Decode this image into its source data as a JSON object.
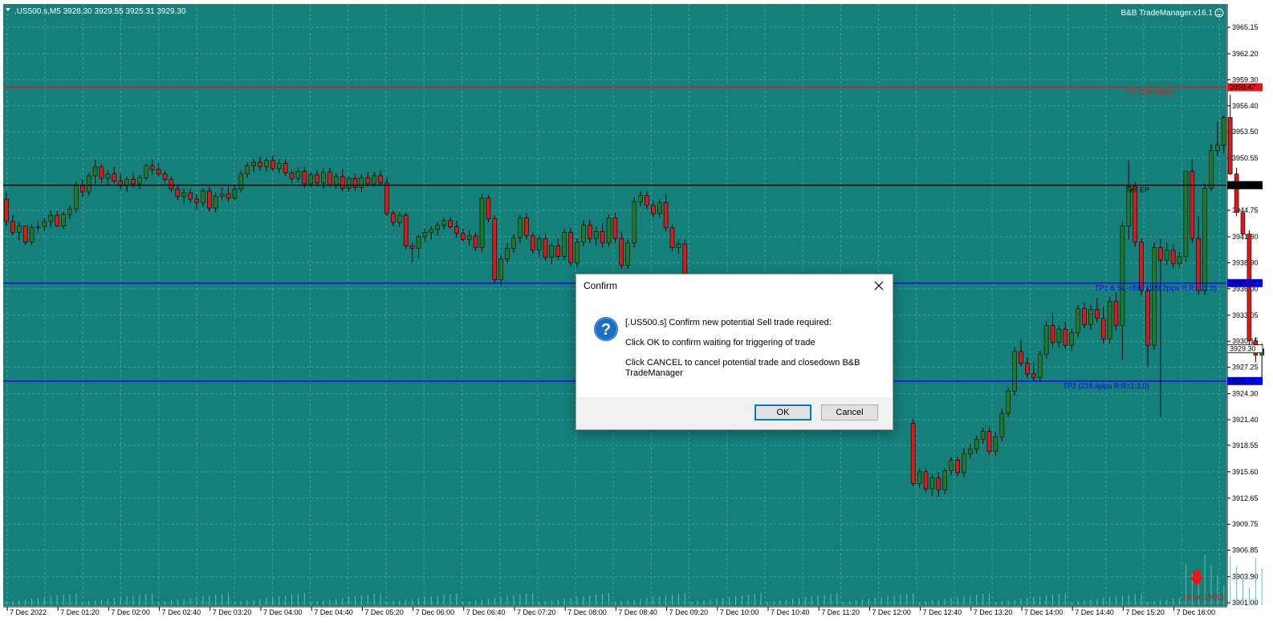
{
  "chart": {
    "symbol_header": ".US500.s,M5  3928.30 3929.55 3925.31 3929.30",
    "ea_label": "B&B TradeManager.v16.1",
    "background": "#148079",
    "grid_color": "#3fa39b",
    "price_ticks": [
      "3965.15",
      "3962.20",
      "3959.30",
      "3956.40",
      "3953.50",
      "3950.55",
      "3947.55",
      "3944.75",
      "3941.80",
      "3938.90",
      "3936.00",
      "3933.05",
      "3930.15",
      "3927.25",
      "3924.30",
      "3921.40",
      "3918.55",
      "3915.60",
      "3912.65",
      "3909.75",
      "3906.85",
      "3903.90",
      "3901.00"
    ],
    "time_ticks": [
      "7 Dec 2022",
      "7 Dec 01:20",
      "7 Dec 02:00",
      "7 Dec 02:40",
      "7 Dec 03:20",
      "7 Dec 04:00",
      "7 Dec 04:40",
      "7 Dec 05:20",
      "7 Dec 06:00",
      "7 Dec 06:40",
      "7 Dec 07:20",
      "7 Dec 08:00",
      "7 Dec 08:40",
      "7 Dec 09:20",
      "7 Dec 10:00",
      "7 Dec 10:40",
      "7 Dec 11:20",
      "7 Dec 12:00",
      "7 Dec 12:40",
      "7 Dec 13:20",
      "7 Dec 14:00",
      "7 Dec 14:40",
      "7 Dec 15:20",
      "7 Dec 16:00"
    ],
    "levels": {
      "sl": {
        "price": 3958.47,
        "label": "SL (108.2pips)",
        "tag": "3958.47",
        "color": "#e3171b"
      },
      "entry": {
        "price": 3947.55,
        "label": "Sell EP",
        "tag": "3947.55",
        "color": "#000000"
      },
      "tp1": {
        "price": 3936.63,
        "label": "TP1 & SL->B/E (109.2pips R:R=1:1.0)",
        "tag": "3936.63",
        "color": "#0000ff"
      },
      "tp2": {
        "price": 3925.71,
        "label": "TP2 (218.4pips R:R=1:2.0)",
        "tag": "3925.71",
        "color": "#0000ff"
      },
      "current": {
        "price": 3929.3,
        "tag": "3929.30"
      }
    },
    "timer": "(0min 10:00)",
    "up_color": "#1e7a2a",
    "down_color": "#d51b1b",
    "arrow_icon": "red-down-arrow-icon"
  },
  "chart_data": {
    "type": "candlestick",
    "ylim": [
      3901.0,
      3965.15
    ],
    "candles": [
      [
        3946.0,
        3946.8,
        3942.9,
        3943.5
      ],
      [
        3943.5,
        3944.2,
        3942.0,
        3942.3
      ],
      [
        3942.3,
        3943.5,
        3941.4,
        3943.0
      ],
      [
        3943.0,
        3943.0,
        3940.9,
        3941.2
      ],
      [
        3941.2,
        3943.2,
        3940.8,
        3942.8
      ],
      [
        3942.8,
        3943.6,
        3942.2,
        3942.9
      ],
      [
        3942.9,
        3943.9,
        3942.4,
        3943.5
      ],
      [
        3943.5,
        3944.8,
        3942.8,
        3944.2
      ],
      [
        3944.2,
        3944.7,
        3942.9,
        3943.0
      ],
      [
        3943.0,
        3944.6,
        3942.7,
        3944.3
      ],
      [
        3944.3,
        3945.3,
        3943.8,
        3944.9
      ],
      [
        3944.9,
        3947.9,
        3944.5,
        3947.5
      ],
      [
        3947.5,
        3948.2,
        3946.2,
        3946.8
      ],
      [
        3946.8,
        3948.9,
        3946.4,
        3948.6
      ],
      [
        3948.6,
        3950.4,
        3947.7,
        3949.6
      ],
      [
        3949.6,
        3949.9,
        3947.8,
        3948.3
      ],
      [
        3948.3,
        3949.2,
        3947.6,
        3948.8
      ],
      [
        3948.8,
        3949.6,
        3947.8,
        3948.0
      ],
      [
        3948.0,
        3948.9,
        3947.1,
        3947.5
      ],
      [
        3947.5,
        3948.5,
        3946.8,
        3948.2
      ],
      [
        3948.2,
        3948.9,
        3947.3,
        3947.7
      ],
      [
        3947.7,
        3948.7,
        3947.1,
        3948.4
      ],
      [
        3948.4,
        3950.0,
        3948.1,
        3949.7
      ],
      [
        3949.7,
        3950.4,
        3948.7,
        3949.3
      ],
      [
        3949.3,
        3950.0,
        3948.5,
        3948.8
      ],
      [
        3948.8,
        3949.2,
        3947.6,
        3948.2
      ],
      [
        3948.2,
        3948.6,
        3946.8,
        3947.1
      ],
      [
        3947.1,
        3947.6,
        3945.9,
        3946.3
      ],
      [
        3946.3,
        3947.1,
        3945.5,
        3946.7
      ],
      [
        3946.7,
        3947.1,
        3945.6,
        3946.0
      ],
      [
        3946.0,
        3946.5,
        3944.8,
        3945.6
      ],
      [
        3945.6,
        3947.2,
        3945.1,
        3946.9
      ],
      [
        3946.9,
        3947.4,
        3944.6,
        3945.0
      ],
      [
        3945.0,
        3946.7,
        3944.5,
        3946.3
      ],
      [
        3946.3,
        3947.3,
        3945.8,
        3946.6
      ],
      [
        3946.6,
        3947.4,
        3945.7,
        3946.1
      ],
      [
        3946.1,
        3947.5,
        3945.9,
        3947.1
      ],
      [
        3947.1,
        3949.2,
        3946.7,
        3948.8
      ],
      [
        3948.8,
        3950.1,
        3948.4,
        3949.7
      ],
      [
        3949.7,
        3950.5,
        3949.0,
        3950.1
      ],
      [
        3950.1,
        3950.7,
        3949.2,
        3949.6
      ],
      [
        3949.6,
        3950.6,
        3949.1,
        3950.3
      ],
      [
        3950.3,
        3950.9,
        3949.2,
        3949.4
      ],
      [
        3949.4,
        3950.5,
        3948.9,
        3950.0
      ],
      [
        3950.0,
        3950.4,
        3948.6,
        3948.9
      ],
      [
        3948.9,
        3949.3,
        3947.7,
        3948.3
      ],
      [
        3948.3,
        3949.6,
        3947.9,
        3949.1
      ],
      [
        3949.1,
        3949.6,
        3947.3,
        3947.7
      ],
      [
        3947.7,
        3949.0,
        3947.3,
        3948.7
      ],
      [
        3948.7,
        3949.2,
        3947.4,
        3947.8
      ],
      [
        3947.8,
        3949.4,
        3947.2,
        3949.0
      ],
      [
        3949.0,
        3949.5,
        3947.4,
        3947.6
      ],
      [
        3947.6,
        3948.9,
        3947.2,
        3948.5
      ],
      [
        3948.5,
        3949.3,
        3946.9,
        3947.2
      ],
      [
        3947.2,
        3948.6,
        3946.8,
        3948.3
      ],
      [
        3948.3,
        3948.8,
        3946.9,
        3947.3
      ],
      [
        3947.3,
        3948.8,
        3946.8,
        3948.4
      ],
      [
        3948.4,
        3949.0,
        3947.4,
        3947.7
      ],
      [
        3947.7,
        3949.0,
        3947.4,
        3948.6
      ],
      [
        3948.6,
        3949.2,
        3947.6,
        3947.8
      ],
      [
        3947.8,
        3948.4,
        3944.1,
        3944.4
      ],
      [
        3944.4,
        3944.7,
        3943.0,
        3943.4
      ],
      [
        3943.4,
        3944.6,
        3942.9,
        3944.2
      ],
      [
        3944.2,
        3944.5,
        3940.4,
        3940.8
      ],
      [
        3940.8,
        3941.1,
        3938.9,
        3940.5
      ],
      [
        3940.5,
        3942.1,
        3939.4,
        3941.8
      ],
      [
        3941.8,
        3942.7,
        3941.2,
        3942.3
      ],
      [
        3942.3,
        3943.0,
        3941.5,
        3942.6
      ],
      [
        3942.6,
        3943.4,
        3941.9,
        3943.1
      ],
      [
        3943.1,
        3943.9,
        3942.6,
        3943.6
      ],
      [
        3943.6,
        3944.0,
        3942.7,
        3942.9
      ],
      [
        3942.9,
        3943.6,
        3941.7,
        3942.2
      ],
      [
        3942.2,
        3942.7,
        3941.3,
        3941.5
      ],
      [
        3941.5,
        3942.5,
        3940.8,
        3941.9
      ],
      [
        3941.9,
        3942.4,
        3940.2,
        3940.6
      ],
      [
        3940.6,
        3946.6,
        3940.1,
        3946.1
      ],
      [
        3946.1,
        3946.5,
        3943.4,
        3943.8
      ],
      [
        3943.8,
        3944.2,
        3936.6,
        3937.0
      ],
      [
        3937.0,
        3939.8,
        3936.4,
        3939.3
      ],
      [
        3939.3,
        3941.1,
        3938.9,
        3940.5
      ],
      [
        3940.5,
        3942.1,
        3940.0,
        3941.7
      ],
      [
        3941.7,
        3944.2,
        3941.1,
        3943.9
      ],
      [
        3943.9,
        3944.4,
        3941.5,
        3941.9
      ],
      [
        3941.9,
        3942.3,
        3939.9,
        3940.3
      ],
      [
        3940.3,
        3942.0,
        3939.5,
        3941.6
      ],
      [
        3941.6,
        3942.1,
        3939.1,
        3939.5
      ],
      [
        3939.5,
        3941.2,
        3938.7,
        3940.8
      ],
      [
        3940.8,
        3941.6,
        3939.2,
        3939.6
      ],
      [
        3939.6,
        3942.7,
        3939.2,
        3942.3
      ],
      [
        3942.3,
        3942.8,
        3938.5,
        3938.9
      ],
      [
        3938.9,
        3941.6,
        3938.4,
        3941.2
      ],
      [
        3941.2,
        3943.6,
        3940.7,
        3943.1
      ],
      [
        3943.1,
        3943.7,
        3941.1,
        3941.6
      ],
      [
        3941.6,
        3942.9,
        3940.8,
        3942.4
      ],
      [
        3942.4,
        3943.3,
        3940.6,
        3941.1
      ],
      [
        3941.1,
        3944.3,
        3940.7,
        3943.9
      ],
      [
        3943.9,
        3944.5,
        3941.1,
        3941.6
      ],
      [
        3941.6,
        3942.4,
        3938.2,
        3938.6
      ],
      [
        3938.6,
        3941.5,
        3938.2,
        3941.1
      ],
      [
        3941.1,
        3946.2,
        3940.6,
        3945.7
      ],
      [
        3945.7,
        3946.9,
        3945.2,
        3946.4
      ],
      [
        3946.4,
        3946.8,
        3944.9,
        3945.3
      ],
      [
        3945.3,
        3945.8,
        3944.0,
        3944.4
      ],
      [
        3944.4,
        3946.0,
        3943.9,
        3945.6
      ],
      [
        3945.6,
        3946.6,
        3942.4,
        3942.8
      ],
      [
        3942.8,
        3943.3,
        3940.2,
        3940.6
      ],
      [
        3940.6,
        3941.5,
        3939.9,
        3941.0
      ],
      [
        3941.0,
        3941.5,
        3936.2,
        3936.7
      ],
      null,
      null,
      null,
      null,
      null,
      null,
      null,
      null,
      null,
      null,
      null,
      null,
      null,
      null,
      null,
      null,
      null,
      null,
      null,
      null,
      null,
      null,
      null,
      null,
      null,
      null,
      null,
      null,
      null,
      null,
      null,
      null,
      null,
      null,
      null,
      [
        3921.0,
        3921.5,
        3914.0,
        3914.3
      ],
      [
        3914.3,
        3916.0,
        3913.8,
        3915.6
      ],
      [
        3915.6,
        3916.1,
        3913.3,
        3913.7
      ],
      [
        3913.7,
        3915.4,
        3912.9,
        3914.9
      ],
      [
        3914.9,
        3915.6,
        3912.8,
        3913.6
      ],
      [
        3913.6,
        3916.0,
        3913.1,
        3915.7
      ],
      [
        3915.7,
        3917.2,
        3915.2,
        3916.9
      ],
      [
        3916.9,
        3917.3,
        3915.1,
        3915.5
      ],
      [
        3915.5,
        3918.2,
        3915.0,
        3917.6
      ],
      [
        3917.6,
        3918.7,
        3917.1,
        3918.1
      ],
      [
        3918.1,
        3919.6,
        3917.6,
        3919.2
      ],
      [
        3919.2,
        3920.5,
        3918.7,
        3920.1
      ],
      [
        3920.1,
        3920.6,
        3917.5,
        3917.9
      ],
      [
        3917.9,
        3920.0,
        3917.4,
        3919.5
      ],
      [
        3919.5,
        3922.6,
        3919.0,
        3922.1
      ],
      [
        3922.1,
        3925.0,
        3921.7,
        3924.6
      ],
      [
        3924.6,
        3929.5,
        3924.1,
        3929.0
      ],
      [
        3929.0,
        3930.3,
        3927.3,
        3927.7
      ],
      [
        3927.7,
        3928.4,
        3926.0,
        3926.5
      ],
      [
        3926.5,
        3927.8,
        3925.7,
        3926.1
      ],
      [
        3926.1,
        3929.1,
        3925.6,
        3928.7
      ],
      [
        3928.7,
        3932.4,
        3928.2,
        3931.9
      ],
      [
        3931.9,
        3933.3,
        3929.5,
        3930.0
      ],
      [
        3930.0,
        3931.9,
        3929.4,
        3931.5
      ],
      [
        3931.5,
        3932.3,
        3929.3,
        3929.7
      ],
      [
        3929.7,
        3931.5,
        3929.1,
        3931.1
      ],
      [
        3931.1,
        3934.2,
        3930.6,
        3933.8
      ],
      [
        3933.8,
        3934.5,
        3931.6,
        3932.0
      ],
      [
        3932.0,
        3934.2,
        3931.4,
        3933.7
      ],
      [
        3933.7,
        3935.0,
        3932.2,
        3932.7
      ],
      [
        3932.7,
        3934.0,
        3929.9,
        3930.4
      ],
      [
        3930.4,
        3935.1,
        3929.9,
        3934.6
      ],
      [
        3934.6,
        3935.6,
        3931.4,
        3931.9
      ],
      [
        3931.9,
        3943.5,
        3928.1,
        3943.0
      ],
      [
        3943.0,
        3950.3,
        3941.5,
        3947.4
      ],
      [
        3947.4,
        3947.9,
        3940.7,
        3941.2
      ],
      [
        3941.2,
        3941.6,
        3935.3,
        3935.8
      ],
      [
        3935.8,
        3936.3,
        3927.4,
        3929.7
      ],
      [
        3929.7,
        3941.1,
        3929.2,
        3940.6
      ],
      [
        3940.6,
        3941.6,
        3921.7,
        3939.2
      ],
      [
        3939.2,
        3941.2,
        3938.7,
        3940.3
      ],
      [
        3940.3,
        3941.0,
        3938.3,
        3938.8
      ],
      [
        3938.8,
        3940.1,
        3938.4,
        3939.6
      ],
      [
        3939.6,
        3946.0,
        3939.0,
        3949.1
      ],
      [
        3949.1,
        3950.4,
        3941.1,
        3941.6
      ],
      [
        3941.6,
        3944.1,
        3935.3,
        3935.8
      ],
      [
        3935.8,
        3947.7,
        3935.3,
        3947.2
      ],
      [
        3947.2,
        3952.1,
        3946.9,
        3951.4
      ],
      [
        3951.4,
        3954.6,
        3950.8,
        3952.0
      ],
      [
        3952.0,
        3955.3,
        3951.1,
        3955.1
      ],
      [
        3955.1,
        3957.6,
        3948.7,
        3948.8
      ],
      [
        3948.8,
        3949.5,
        3944.1,
        3944.5
      ],
      [
        3944.5,
        3945.0,
        3941.5,
        3942.1
      ],
      [
        3942.1,
        3942.5,
        3929.4,
        3930.2
      ],
      [
        3930.2,
        3930.6,
        3927.8,
        3928.6
      ],
      [
        3928.6,
        3929.9,
        3925.3,
        3929.3
      ]
    ],
    "volume_note": "tick volume histogram at bottom"
  },
  "dialog": {
    "title": "Confirm",
    "close_icon": "close-icon",
    "icon": "question-icon",
    "message_line1": "[.US500.s] Confirm new potential Sell trade required:",
    "message_line2": "Click OK  to confirm waiting for triggering of trade",
    "message_line3": "Click CANCEL to cancel potential trade and closedown B&B TradeManager",
    "ok_label": "OK",
    "cancel_label": "Cancel"
  }
}
